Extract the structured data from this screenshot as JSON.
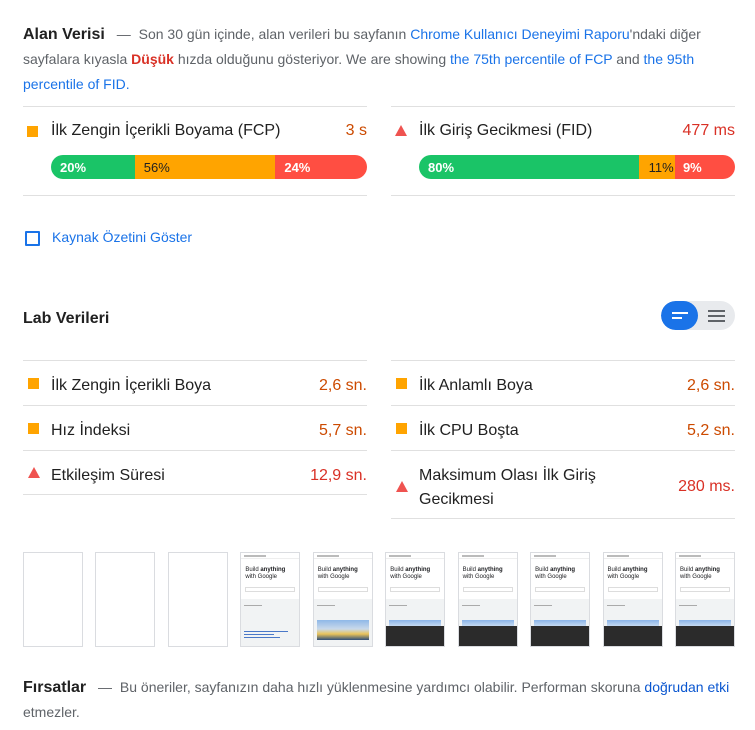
{
  "field": {
    "title": "Alan Verisi",
    "dash": "—",
    "desc_1": "Son 30 gün içinde, alan verileri bu sayfanın",
    "link_crux": "Chrome Kullanıcı Deneyimi Raporu",
    "desc_2": "'ndaki diğer sayfalara kıyasla",
    "speed_word": "Düşük",
    "desc_3": "hızda olduğunu gösteriyor. We are showing",
    "link_fcp": "the 75th percentile of FCP",
    "desc_4": "and",
    "link_fid": "the 95th percentile of FID.",
    "metrics": [
      {
        "name": "İlk Zengin İçerikli Boyama (FCP)",
        "value": "3 s",
        "icon": "average-square-icon",
        "dist": [
          {
            "label": "20%",
            "pct": 20
          },
          {
            "label": "56%",
            "pct": 56
          },
          {
            "label": "24%",
            "pct": 24
          }
        ]
      },
      {
        "name": "İlk Giriş Gecikmesi (FID)",
        "value": "477 ms",
        "icon": "fail-triangle-icon",
        "dist": [
          {
            "label": "80%",
            "pct": 80
          },
          {
            "label": "11%",
            "pct": 11
          },
          {
            "label": "9%",
            "pct": 9
          }
        ]
      }
    ]
  },
  "origin_summary": {
    "label": "Kaynak Özetini Göster",
    "checked": false
  },
  "lab": {
    "title": "Lab Verileri",
    "view_toggle": {
      "options": [
        "list-view-icon",
        "details-view-icon"
      ],
      "active": "list-view-icon"
    },
    "left": [
      {
        "name": "İlk Zengin İçerikli Boya",
        "value": "2,6 sn.",
        "status": "average"
      },
      {
        "name": "Hız İndeksi",
        "value": "5,7 sn.",
        "status": "average"
      },
      {
        "name": "Etkileşim Süresi",
        "value": "12,9 sn.",
        "status": "fail"
      }
    ],
    "right": [
      {
        "name": "İlk Anlamlı Boya",
        "value": "2,6 sn.",
        "status": "average"
      },
      {
        "name": "İlk CPU Boşta",
        "value": "5,2 sn.",
        "status": "average"
      },
      {
        "name": "Maksimum Olası İlk Giriş Gecikmesi",
        "value": "280 ms.",
        "status": "fail"
      }
    ]
  },
  "filmstrip": {
    "frames": [
      {
        "state": "blank"
      },
      {
        "state": "blank"
      },
      {
        "state": "blank"
      },
      {
        "state": "partial"
      },
      {
        "state": "image"
      },
      {
        "state": "full"
      },
      {
        "state": "full"
      },
      {
        "state": "full"
      },
      {
        "state": "full"
      },
      {
        "state": "full"
      }
    ],
    "frame_headline_1": "Build",
    "frame_headline_bold": "anything",
    "frame_headline_2": "with Google"
  },
  "opportunities": {
    "title": "Fırsatlar",
    "dash": "—",
    "desc": "Bu öneriler, sayfanızın daha hızlı yüklenmesine yardımcı olabilir. Performan skoruna",
    "link": "doğrudan etki",
    "desc_end": "etmezler."
  },
  "colors": {
    "fast": "#1ac467",
    "average": "#ffa400",
    "slow": "#ff4e42",
    "link": "#1a73e8"
  }
}
